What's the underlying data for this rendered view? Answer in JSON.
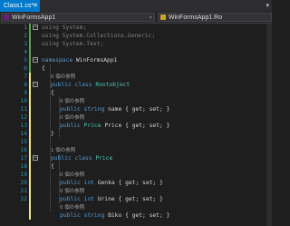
{
  "tabs": [
    {
      "label": "Class1.cs*",
      "close": "✕"
    }
  ],
  "tab_dropdown": "▾",
  "nav": {
    "project": "WinFormsApp1",
    "scope": "WinFormsApp1.Ro",
    "caret": "▾"
  },
  "fold": {
    "open": "−"
  },
  "refs": {
    "zero": "0 個の参照",
    "one": "1 個の参照"
  },
  "code": {
    "using": "using",
    "ns_system": "System;",
    "ns_generic": "System.Collections.Generic;",
    "ns_text": "System.Text;",
    "namespace_kw": "namespace",
    "namespace_name": "WinFormsApp1",
    "brace_open": "{",
    "brace_close": "}",
    "public": "public",
    "class_kw": "class",
    "class_root": "Rootobject",
    "class_price": "Price",
    "string_kw": "string",
    "int_kw": "int",
    "prop_name": "name",
    "type_price": "Price",
    "prop_price": "Price",
    "prop_genka": "Genka",
    "prop_urine": "Urine",
    "prop_biko": "Biko",
    "accessors": "{ get; set; }"
  },
  "line_numbers": [
    "1",
    "2",
    "3",
    "4",
    "5",
    "6",
    "7",
    "8",
    "9",
    "10",
    "11",
    "12",
    "13",
    "14",
    "15",
    "16",
    "17",
    "18",
    "19",
    "20",
    "21",
    "22"
  ]
}
